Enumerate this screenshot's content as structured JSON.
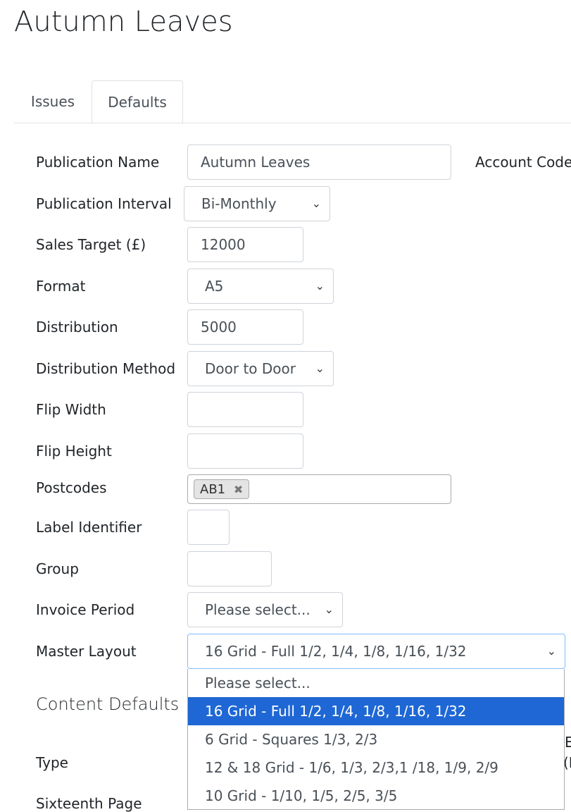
{
  "page": {
    "title": "Autumn Leaves"
  },
  "tabs": [
    {
      "label": "Issues",
      "active": false
    },
    {
      "label": "Defaults",
      "active": true
    }
  ],
  "form": {
    "publication_name": {
      "label": "Publication Name",
      "value": "Autumn Leaves"
    },
    "account_code": {
      "label": "Account Code"
    },
    "publication_interval": {
      "label": "Publication Interval",
      "value": "Bi-Monthly"
    },
    "sales_target": {
      "label": "Sales Target (£)",
      "value": "12000"
    },
    "format": {
      "label": "Format",
      "value": "A5"
    },
    "distribution": {
      "label": "Distribution",
      "value": "5000"
    },
    "distribution_method": {
      "label": "Distribution Method",
      "value": "Door to Door"
    },
    "flip_width": {
      "label": "Flip Width",
      "value": ""
    },
    "flip_height": {
      "label": "Flip Height",
      "value": ""
    },
    "postcodes": {
      "label": "Postcodes",
      "tags": [
        "AB1"
      ],
      "remove_glyph": "✖"
    },
    "label_identifier": {
      "label": "Label Identifier",
      "value": ""
    },
    "group": {
      "label": "Group",
      "value": ""
    },
    "invoice_period": {
      "label": "Invoice Period",
      "value": "Please select..."
    },
    "master_layout": {
      "label": "Master Layout",
      "value": "16 Grid - Full 1/2, 1/4, 1/8, 1/16, 1/32",
      "options": [
        "Please select...",
        "16 Grid - Full 1/2, 1/4, 1/8, 1/16, 1/32",
        "6 Grid - Squares 1/3, 2/3",
        "12 & 18 Grid - 1/6, 1/3, 2/3,1 /18, 1/9, 2/9",
        "10 Grid - 1/10, 1/5, 2/5, 3/5"
      ],
      "selected_index": 1
    }
  },
  "content_defaults": {
    "title": "Content Defaults",
    "type_label": "Type",
    "sixteenth_label": "Sixteenth Page",
    "clipped_right_1": "E",
    "clipped_right_2": "(I"
  },
  "icons": {
    "chevron": "chevron-down-icon",
    "remove": "remove-tag-icon"
  }
}
